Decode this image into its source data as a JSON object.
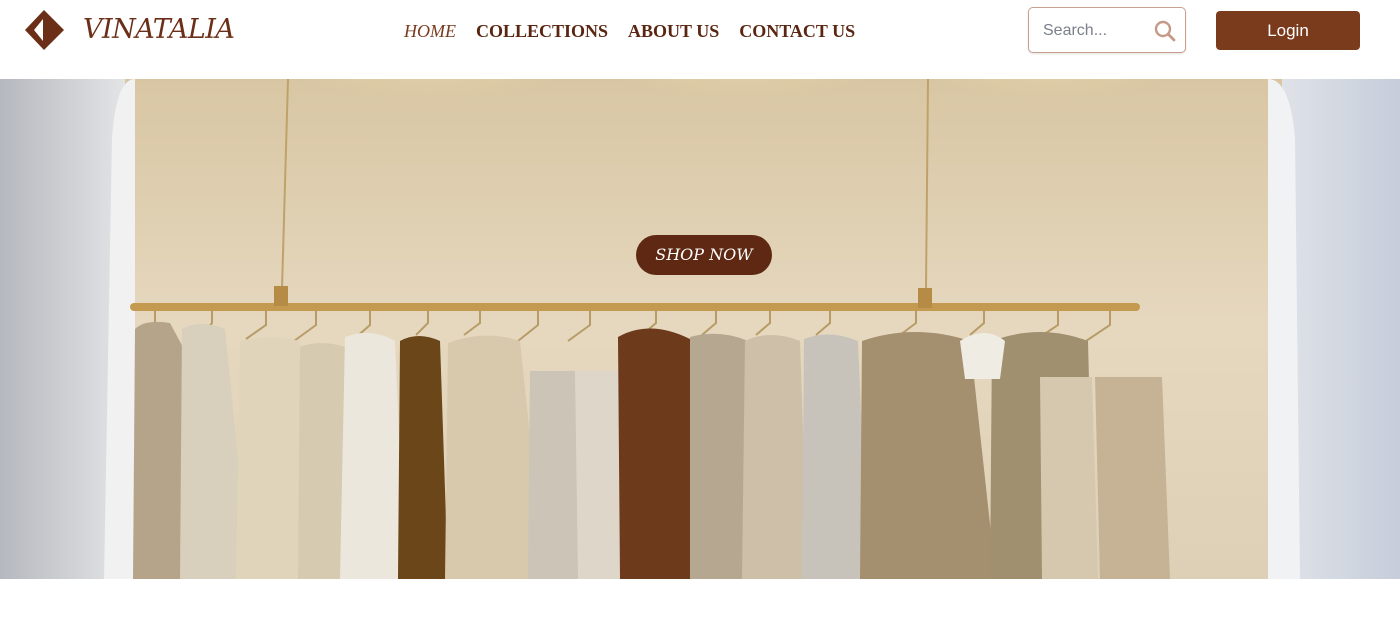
{
  "brand": {
    "name": "VINATALIA",
    "color": "#6b2e16"
  },
  "nav": {
    "items": [
      {
        "label": "HOME",
        "active": true
      },
      {
        "label": "COLLECTIONS",
        "active": false
      },
      {
        "label": "ABOUT US",
        "active": false
      },
      {
        "label": "CONTACT US",
        "active": false
      }
    ]
  },
  "search": {
    "placeholder": "Search...",
    "value": "",
    "icon": "search-icon"
  },
  "login": {
    "label": "Login",
    "color": "#7a3a1c"
  },
  "hero": {
    "cta_label": "SHOP NOW",
    "cta_color": "#5e2812",
    "image": "clothing-rack-photo"
  }
}
